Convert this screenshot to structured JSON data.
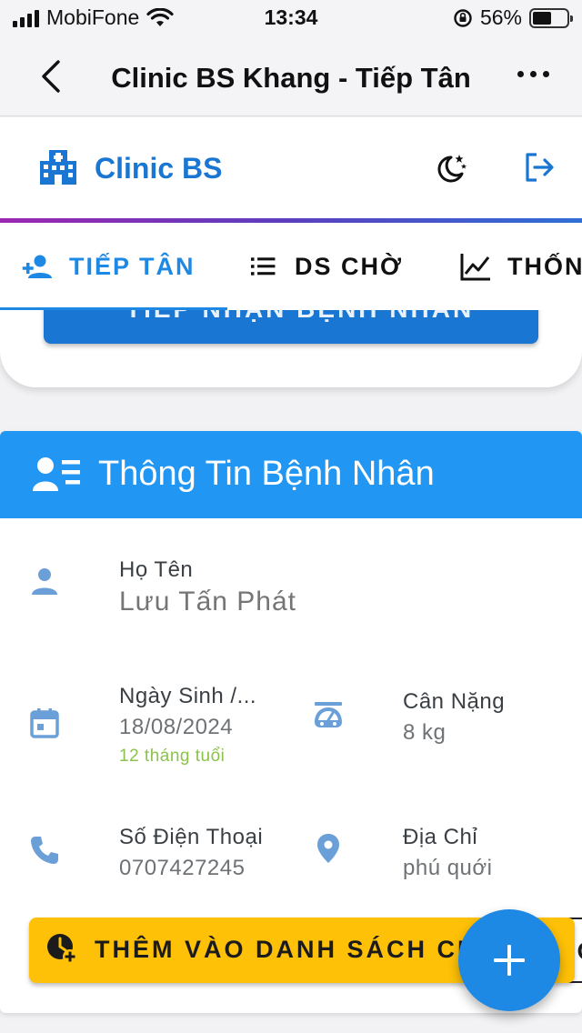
{
  "status_bar": {
    "carrier": "MobiFone",
    "time": "13:34",
    "battery": "56%",
    "battery_level": 0.56,
    "icons": [
      "signal-icon",
      "wifi-icon",
      "rotation-lock-icon",
      "battery-icon"
    ]
  },
  "nav": {
    "title": "Clinic BS Khang - Tiếp Tân",
    "icons": [
      "back-chevron-icon",
      "more-dots-icon"
    ]
  },
  "app_header": {
    "brand": "Clinic BS",
    "brand_color": "#1976d2",
    "icons": [
      "hospital-building-icon",
      "dark-mode-moon-icon",
      "logout-icon"
    ]
  },
  "tabs": [
    {
      "label": "TIẾP TÂN",
      "icon": "person-add-icon",
      "active": true
    },
    {
      "label": "DS CHỜ",
      "icon": "list-icon",
      "active": false
    },
    {
      "label": "THỐN",
      "icon": "line-chart-icon",
      "active": false
    }
  ],
  "previous_card": {
    "button_label": "TIẾP NHẬN BỆNH NHÂN"
  },
  "patient_card": {
    "title": "Thông Tin Bệnh Nhân",
    "header_color": "#2196f3",
    "fields": {
      "name": {
        "label": "Họ Tên",
        "value": "Lưu Tấn Phát",
        "icon": "person-icon"
      },
      "dob": {
        "label": "Ngày Sinh /...",
        "value": "18/08/2024",
        "hint": "12 tháng tuổi",
        "icon": "calendar-icon"
      },
      "weight": {
        "label": "Cân Nặng",
        "value": "8 kg",
        "icon": "scale-icon"
      },
      "phone": {
        "label": "Số Điện Thoại",
        "value": "0707427245",
        "icon": "phone-icon"
      },
      "address": {
        "label": "Địa Chỉ",
        "value": "phú quới",
        "icon": "location-pin-icon"
      }
    },
    "add_button": {
      "label": "THÊM VÀO DANH SÁCH CH",
      "icon": "clock-add-icon",
      "color": "#ffc107"
    },
    "second_button": {
      "label": "ĐỔ"
    }
  },
  "fab": {
    "icon": "plus-icon",
    "color": "#1e88e5"
  }
}
